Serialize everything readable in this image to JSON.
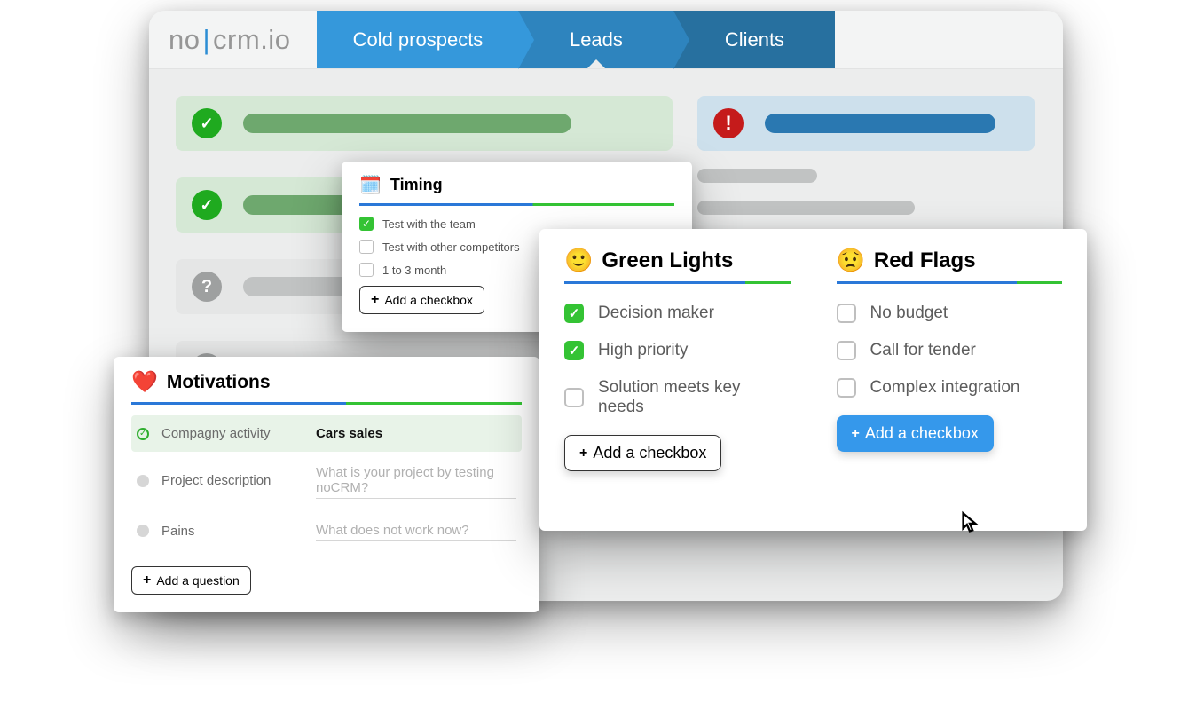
{
  "brand": {
    "left": "no",
    "pipe": "|",
    "right": "crm.io"
  },
  "tabs": {
    "cold": "Cold prospects",
    "leads": "Leads",
    "clients": "Clients"
  },
  "timing": {
    "title": "Timing",
    "items": [
      {
        "label": "Test with the team",
        "checked": true
      },
      {
        "label": "Test with other competitors",
        "checked": false
      },
      {
        "label": "1 to 3 month",
        "checked": false
      }
    ],
    "add": "Add a checkbox"
  },
  "motivations": {
    "title": "Motivations",
    "rows": [
      {
        "label": "Compagny activity",
        "value": "Cars sales",
        "filled": true
      },
      {
        "label": "Project description",
        "placeholder": "What is your project by testing noCRM?"
      },
      {
        "label": "Pains",
        "placeholder": "What does not work now?"
      }
    ],
    "add": "Add a question"
  },
  "greenLights": {
    "title": "Green Lights",
    "items": [
      {
        "label": "Decision maker",
        "checked": true
      },
      {
        "label": "High priority",
        "checked": true
      },
      {
        "label": "Solution meets key needs",
        "checked": false
      }
    ],
    "add": "Add a checkbox"
  },
  "redFlags": {
    "title": "Red Flags",
    "items": [
      {
        "label": "No budget",
        "checked": false
      },
      {
        "label": "Call for tender",
        "checked": false
      },
      {
        "label": "Complex integration",
        "checked": false
      }
    ],
    "add": "Add a checkbox"
  }
}
